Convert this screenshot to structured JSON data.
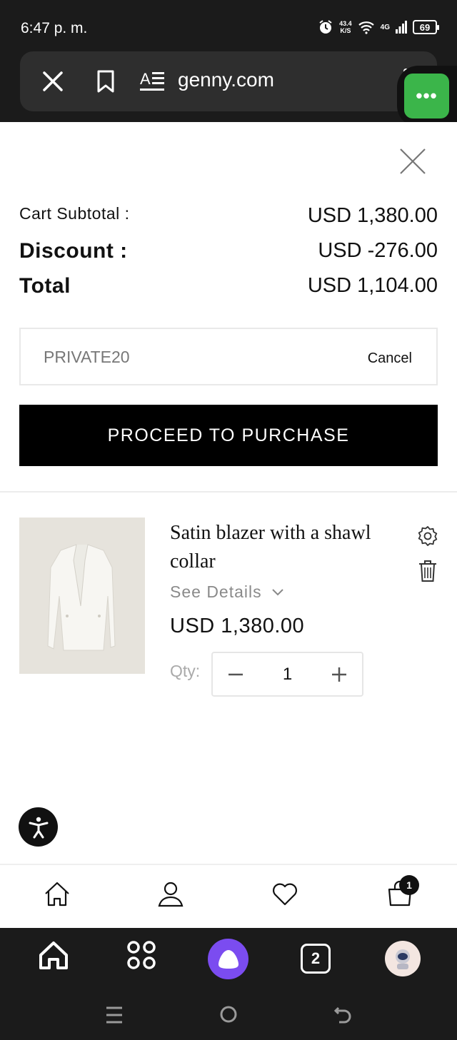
{
  "status_bar": {
    "time": "6:47 p. m.",
    "speed_value": "43.4",
    "speed_unit": "K/S",
    "network": "4G",
    "battery": "69"
  },
  "browser": {
    "url": "genny.com",
    "menu_label": "•••"
  },
  "cart": {
    "subtotal_label": "Cart Subtotal :",
    "subtotal_value": "USD 1,380.00",
    "discount_label": "Discount :",
    "discount_value": "USD -276.00",
    "total_label": "Total",
    "total_value": "USD 1,104.00",
    "coupon_code": "PRIVATE20",
    "coupon_cancel": "Cancel",
    "proceed_label": "PROCEED TO PURCHASE"
  },
  "item": {
    "title": "Satin blazer with a shawl collar",
    "see_details": "See Details",
    "price": "USD 1,380.00",
    "qty_label": "Qty:",
    "qty_value": "1"
  },
  "bottom_nav": {
    "cart_badge": "1",
    "items": [
      "home-icon",
      "account-icon",
      "wishlist-icon",
      "cart-icon"
    ]
  },
  "app_bar": {
    "tabs_count": "2"
  },
  "colors": {
    "dark_bg": "#1b1b1b",
    "accent_green": "#3bb54a",
    "alice_purple": "#7b4cf0",
    "button_black": "#000000"
  }
}
